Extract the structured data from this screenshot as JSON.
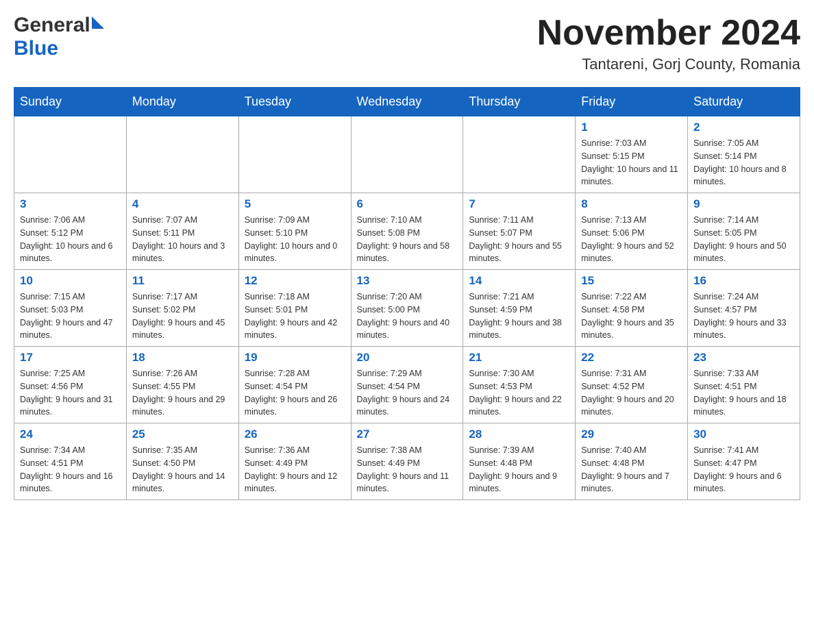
{
  "header": {
    "title": "November 2024",
    "location": "Tantareni, Gorj County, Romania"
  },
  "logo": {
    "general": "General",
    "blue": "Blue"
  },
  "days_of_week": [
    "Sunday",
    "Monday",
    "Tuesday",
    "Wednesday",
    "Thursday",
    "Friday",
    "Saturday"
  ],
  "weeks": [
    [
      {
        "day": "",
        "info": ""
      },
      {
        "day": "",
        "info": ""
      },
      {
        "day": "",
        "info": ""
      },
      {
        "day": "",
        "info": ""
      },
      {
        "day": "",
        "info": ""
      },
      {
        "day": "1",
        "info": "Sunrise: 7:03 AM\nSunset: 5:15 PM\nDaylight: 10 hours and 11 minutes."
      },
      {
        "day": "2",
        "info": "Sunrise: 7:05 AM\nSunset: 5:14 PM\nDaylight: 10 hours and 8 minutes."
      }
    ],
    [
      {
        "day": "3",
        "info": "Sunrise: 7:06 AM\nSunset: 5:12 PM\nDaylight: 10 hours and 6 minutes."
      },
      {
        "day": "4",
        "info": "Sunrise: 7:07 AM\nSunset: 5:11 PM\nDaylight: 10 hours and 3 minutes."
      },
      {
        "day": "5",
        "info": "Sunrise: 7:09 AM\nSunset: 5:10 PM\nDaylight: 10 hours and 0 minutes."
      },
      {
        "day": "6",
        "info": "Sunrise: 7:10 AM\nSunset: 5:08 PM\nDaylight: 9 hours and 58 minutes."
      },
      {
        "day": "7",
        "info": "Sunrise: 7:11 AM\nSunset: 5:07 PM\nDaylight: 9 hours and 55 minutes."
      },
      {
        "day": "8",
        "info": "Sunrise: 7:13 AM\nSunset: 5:06 PM\nDaylight: 9 hours and 52 minutes."
      },
      {
        "day": "9",
        "info": "Sunrise: 7:14 AM\nSunset: 5:05 PM\nDaylight: 9 hours and 50 minutes."
      }
    ],
    [
      {
        "day": "10",
        "info": "Sunrise: 7:15 AM\nSunset: 5:03 PM\nDaylight: 9 hours and 47 minutes."
      },
      {
        "day": "11",
        "info": "Sunrise: 7:17 AM\nSunset: 5:02 PM\nDaylight: 9 hours and 45 minutes."
      },
      {
        "day": "12",
        "info": "Sunrise: 7:18 AM\nSunset: 5:01 PM\nDaylight: 9 hours and 42 minutes."
      },
      {
        "day": "13",
        "info": "Sunrise: 7:20 AM\nSunset: 5:00 PM\nDaylight: 9 hours and 40 minutes."
      },
      {
        "day": "14",
        "info": "Sunrise: 7:21 AM\nSunset: 4:59 PM\nDaylight: 9 hours and 38 minutes."
      },
      {
        "day": "15",
        "info": "Sunrise: 7:22 AM\nSunset: 4:58 PM\nDaylight: 9 hours and 35 minutes."
      },
      {
        "day": "16",
        "info": "Sunrise: 7:24 AM\nSunset: 4:57 PM\nDaylight: 9 hours and 33 minutes."
      }
    ],
    [
      {
        "day": "17",
        "info": "Sunrise: 7:25 AM\nSunset: 4:56 PM\nDaylight: 9 hours and 31 minutes."
      },
      {
        "day": "18",
        "info": "Sunrise: 7:26 AM\nSunset: 4:55 PM\nDaylight: 9 hours and 29 minutes."
      },
      {
        "day": "19",
        "info": "Sunrise: 7:28 AM\nSunset: 4:54 PM\nDaylight: 9 hours and 26 minutes."
      },
      {
        "day": "20",
        "info": "Sunrise: 7:29 AM\nSunset: 4:54 PM\nDaylight: 9 hours and 24 minutes."
      },
      {
        "day": "21",
        "info": "Sunrise: 7:30 AM\nSunset: 4:53 PM\nDaylight: 9 hours and 22 minutes."
      },
      {
        "day": "22",
        "info": "Sunrise: 7:31 AM\nSunset: 4:52 PM\nDaylight: 9 hours and 20 minutes."
      },
      {
        "day": "23",
        "info": "Sunrise: 7:33 AM\nSunset: 4:51 PM\nDaylight: 9 hours and 18 minutes."
      }
    ],
    [
      {
        "day": "24",
        "info": "Sunrise: 7:34 AM\nSunset: 4:51 PM\nDaylight: 9 hours and 16 minutes."
      },
      {
        "day": "25",
        "info": "Sunrise: 7:35 AM\nSunset: 4:50 PM\nDaylight: 9 hours and 14 minutes."
      },
      {
        "day": "26",
        "info": "Sunrise: 7:36 AM\nSunset: 4:49 PM\nDaylight: 9 hours and 12 minutes."
      },
      {
        "day": "27",
        "info": "Sunrise: 7:38 AM\nSunset: 4:49 PM\nDaylight: 9 hours and 11 minutes."
      },
      {
        "day": "28",
        "info": "Sunrise: 7:39 AM\nSunset: 4:48 PM\nDaylight: 9 hours and 9 minutes."
      },
      {
        "day": "29",
        "info": "Sunrise: 7:40 AM\nSunset: 4:48 PM\nDaylight: 9 hours and 7 minutes."
      },
      {
        "day": "30",
        "info": "Sunrise: 7:41 AM\nSunset: 4:47 PM\nDaylight: 9 hours and 6 minutes."
      }
    ]
  ]
}
